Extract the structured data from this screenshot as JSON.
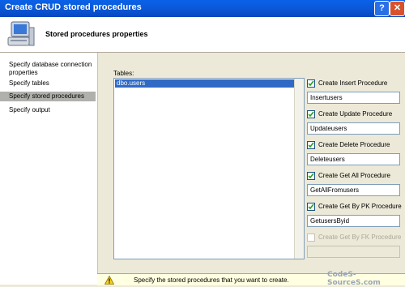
{
  "window": {
    "title": "Create CRUD stored procedures",
    "help_glyph": "?",
    "close_glyph": "✕"
  },
  "header": {
    "title": "Stored procedures properties",
    "icon": "computer-icon"
  },
  "nav": {
    "items": [
      {
        "label": "Specify database connection properties",
        "selected": false
      },
      {
        "label": "Specify tables",
        "selected": false
      },
      {
        "label": "Specify stored procedures",
        "selected": true
      },
      {
        "label": "Specify output",
        "selected": false
      }
    ]
  },
  "tables": {
    "label": "Tables:",
    "rows": [
      "dbo.users"
    ]
  },
  "procedures": [
    {
      "label": "Create Insert Procedure",
      "checked": true,
      "enabled": true,
      "value": "Insertusers"
    },
    {
      "label": "Create Update Procedure",
      "checked": true,
      "enabled": true,
      "value": "Updateusers"
    },
    {
      "label": "Create Delete Procedure",
      "checked": true,
      "enabled": true,
      "value": "Deleteusers"
    },
    {
      "label": "Create Get All Procedure",
      "checked": true,
      "enabled": true,
      "value": "GetAllFromusers"
    },
    {
      "label": "Create Get By PK Procedure",
      "checked": true,
      "enabled": true,
      "value": "GetusersByid"
    },
    {
      "label": "Create Get By FK Procedure",
      "checked": false,
      "enabled": false,
      "value": ""
    }
  ],
  "footer": {
    "message": "Specify the stored procedures that you want to create.",
    "icon": "warning-icon"
  },
  "watermark": "CodeS-SourceS.com"
}
